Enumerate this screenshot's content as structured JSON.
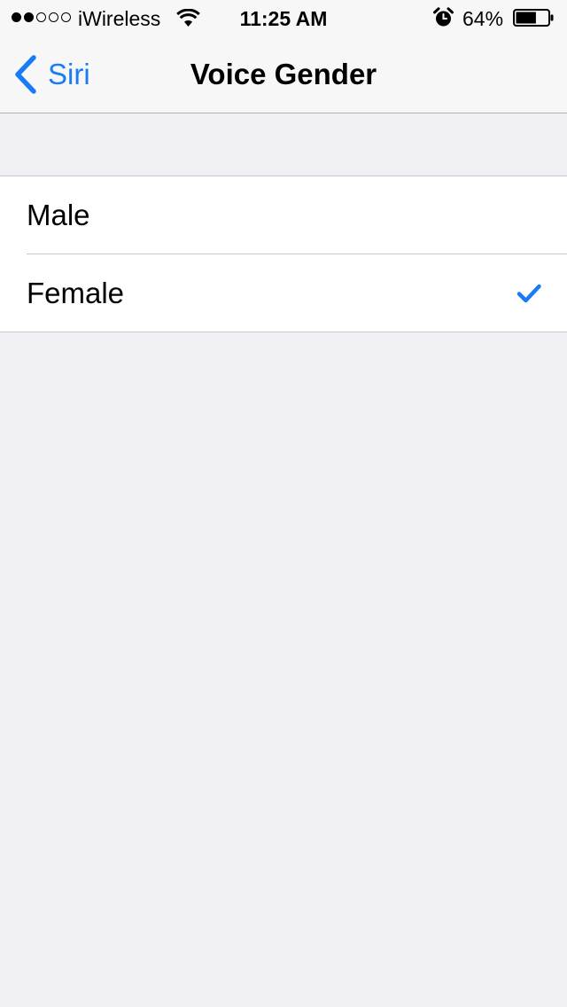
{
  "status_bar": {
    "signal_filled": 2,
    "signal_total": 5,
    "carrier": "iWireless",
    "time": "11:25 AM",
    "battery_percent_text": "64%",
    "battery_level": 0.64
  },
  "nav": {
    "back_label": "Siri",
    "title": "Voice Gender"
  },
  "options": [
    {
      "label": "Male",
      "selected": false
    },
    {
      "label": "Female",
      "selected": true
    }
  ],
  "colors": {
    "accent": "#1a7cf4",
    "background": "#efeff4",
    "bar": "#f7f7f8"
  }
}
